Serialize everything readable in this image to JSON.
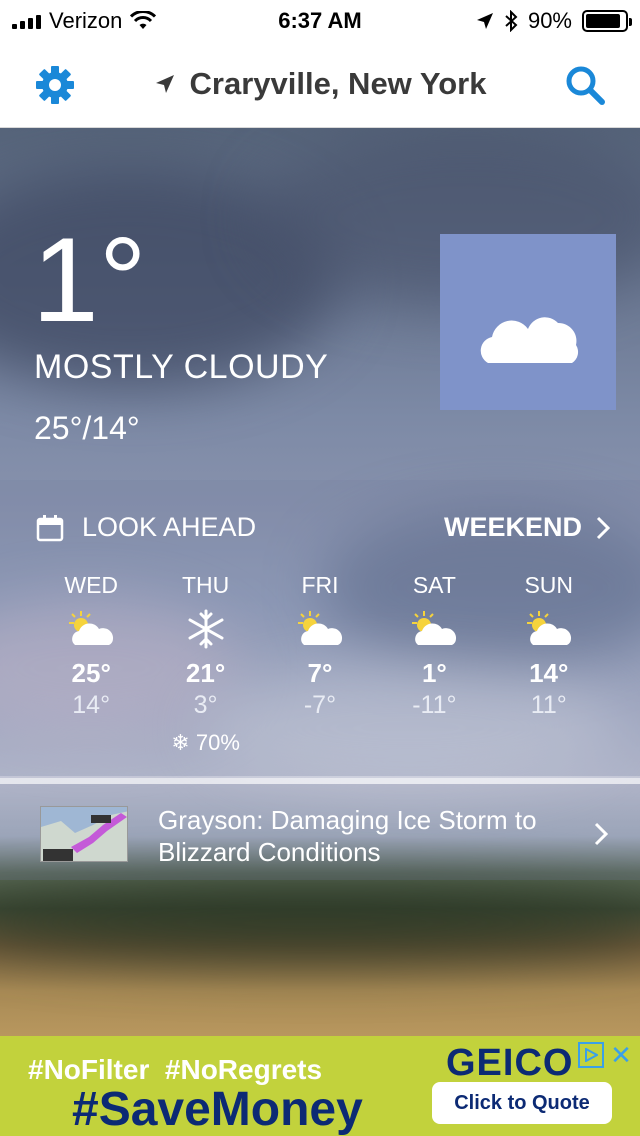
{
  "status": {
    "carrier": "Verizon",
    "time": "6:37 AM",
    "battery": "90%",
    "battery_level": 0.9
  },
  "nav": {
    "location": "Craryville, New York"
  },
  "current": {
    "temp": "1°",
    "condition": "MOSTLY CLOUDY",
    "hilo": "25°/14°",
    "icon": "moon-cloud-icon"
  },
  "lookahead": {
    "title": "LOOK AHEAD",
    "link": "WEEKEND",
    "days": [
      {
        "name": "WED",
        "icon": "partly-cloudy-icon",
        "hi": "25°",
        "lo": "14°",
        "precip": ""
      },
      {
        "name": "THU",
        "icon": "snowflake-icon",
        "hi": "21°",
        "lo": "3°",
        "precip": "70%"
      },
      {
        "name": "FRI",
        "icon": "partly-cloudy-icon",
        "hi": "7°",
        "lo": "-7°",
        "precip": ""
      },
      {
        "name": "SAT",
        "icon": "partly-cloudy-icon",
        "hi": "1°",
        "lo": "-11°",
        "precip": ""
      },
      {
        "name": "SUN",
        "icon": "partly-cloudy-icon",
        "hi": "14°",
        "lo": "11°",
        "precip": ""
      }
    ]
  },
  "story": {
    "headline": "Grayson: Damaging Ice Storm to Blizzard Conditions"
  },
  "ad": {
    "tags": "#NoFilter  #NoRegrets",
    "slogan": "#SaveMoney",
    "brand": "GEICO",
    "cta": "Click to Quote"
  },
  "colors": {
    "accent": "#1a88d8",
    "tile": "#7f93c9",
    "ad_bg": "#c2d23c",
    "ad_text": "#0c2a74"
  }
}
